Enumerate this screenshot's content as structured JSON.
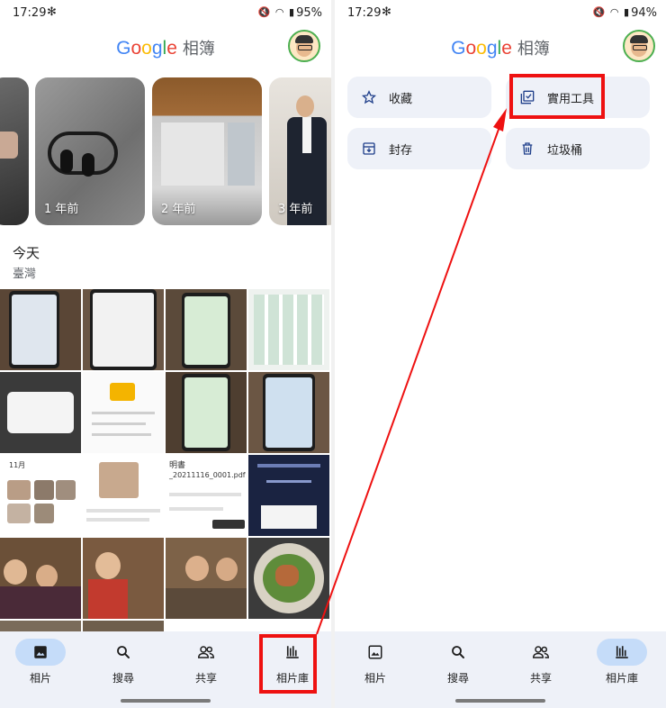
{
  "left": {
    "status": {
      "time": "17:29",
      "battery": "95%"
    },
    "app_title_brand": "Google",
    "app_title_suffix": "相簿",
    "memories": [
      {
        "label": ""
      },
      {
        "label": "1 年前"
      },
      {
        "label": "2 年前"
      },
      {
        "label": "3 年前"
      }
    ],
    "section_title": "今天",
    "section_location": "臺灣",
    "tile_texts": {
      "month": "11月",
      "pdf_name": "_20211116_0001.pdf",
      "doc_prefix": "明書"
    },
    "nav": [
      {
        "label": "相片",
        "icon": "photo-icon",
        "active": true
      },
      {
        "label": "搜尋",
        "icon": "search-icon",
        "active": false
      },
      {
        "label": "共享",
        "icon": "people-icon",
        "active": false
      },
      {
        "label": "相片庫",
        "icon": "library-icon",
        "active": false
      }
    ]
  },
  "right": {
    "status": {
      "time": "17:29",
      "battery": "94%"
    },
    "app_title_brand": "Google",
    "app_title_suffix": "相簿",
    "library_buttons": [
      {
        "label": "收藏",
        "icon": "star-icon"
      },
      {
        "label": "實用工具",
        "icon": "utilities-icon"
      },
      {
        "label": "封存",
        "icon": "archive-icon"
      },
      {
        "label": "垃圾桶",
        "icon": "trash-icon"
      }
    ],
    "nav": [
      {
        "label": "相片",
        "icon": "photo-icon",
        "active": false
      },
      {
        "label": "搜尋",
        "icon": "search-icon",
        "active": false
      },
      {
        "label": "共享",
        "icon": "people-icon",
        "active": false
      },
      {
        "label": "相片庫",
        "icon": "library-icon",
        "active": true
      }
    ]
  },
  "colors": {
    "accent": "#c5dcf9",
    "annotation_red": "#ee1111",
    "nav_bg": "#eef1f8"
  }
}
